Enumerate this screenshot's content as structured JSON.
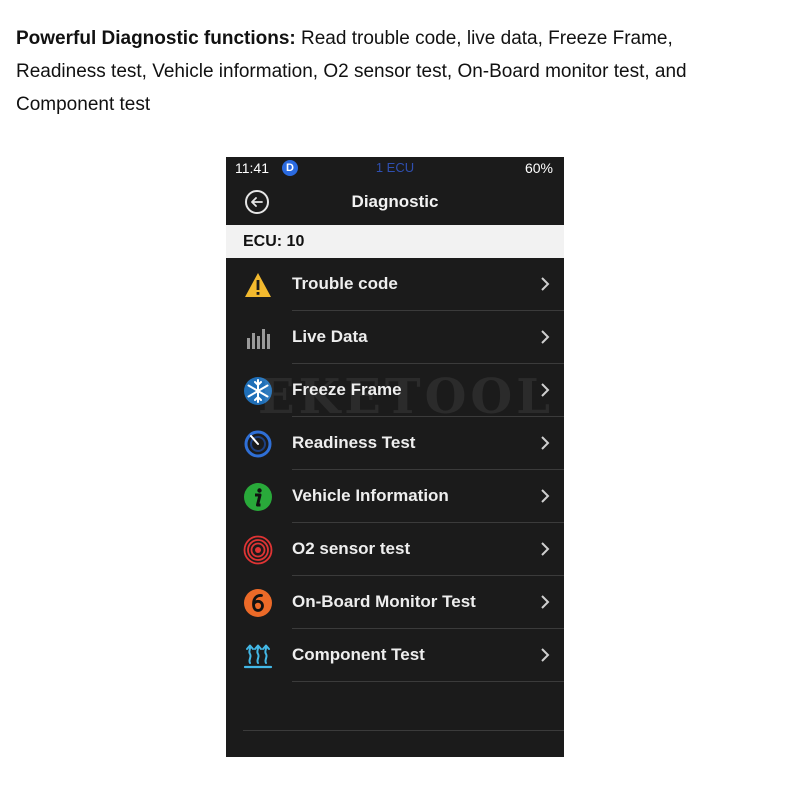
{
  "caption": {
    "bold": "Powerful Diagnostic functions:",
    "text": "Read trouble code, live data, Freeze Frame, Readiness test, Vehicle information, O2 sensor test, On-Board monitor test, and Component test"
  },
  "status_bar": {
    "time": "11:41",
    "badge": "D",
    "center": "1 ECU",
    "battery": "60%"
  },
  "nav": {
    "title": "Diagnostic"
  },
  "ecu_label": "ECU: 10",
  "watermark": "EKETOOL",
  "menu": [
    {
      "label": "Trouble code",
      "icon": "warning-icon"
    },
    {
      "label": "Live Data",
      "icon": "bar-chart-icon"
    },
    {
      "label": "Freeze Frame",
      "icon": "snowflake-icon"
    },
    {
      "label": "Readiness Test",
      "icon": "gauge-icon"
    },
    {
      "label": "Vehicle Information",
      "icon": "info-icon"
    },
    {
      "label": "O2 sensor test",
      "icon": "o2-target-icon"
    },
    {
      "label": "On-Board Monitor Test",
      "icon": "mode-six-icon"
    },
    {
      "label": "Component Test",
      "icon": "heat-arrows-icon"
    }
  ],
  "colors": {
    "background": "#1b1b1b",
    "ecu_bar": "#f2f2f2",
    "warning": "#f2b92e",
    "snowflake": "#3aa7e8",
    "gauge": "#2f6fd6",
    "info": "#29a93a",
    "o2": "#e03434",
    "mode_six": "#ec6a28",
    "heat": "#43b8e6"
  }
}
